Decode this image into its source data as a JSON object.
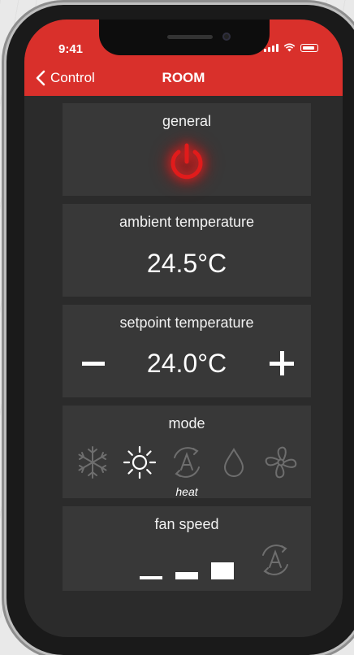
{
  "status_bar": {
    "time": "9:41"
  },
  "nav": {
    "back_label": "Control",
    "title": "ROOM"
  },
  "general": {
    "title": "general",
    "power_icon": "power-icon",
    "power_color": "#e11b1b"
  },
  "ambient": {
    "title": "ambient temperature",
    "value": "24.5°C"
  },
  "setpoint": {
    "title": "setpoint temperature",
    "value": "24.0°C"
  },
  "mode": {
    "title": "mode",
    "options": [
      "cool-icon",
      "heat-icon",
      "auto-icon",
      "dry-icon",
      "fan-icon"
    ],
    "selected_label": "heat"
  },
  "fan_speed": {
    "title": "fan speed",
    "options": [
      "low",
      "medium",
      "high",
      "auto"
    ]
  },
  "colors": {
    "accent": "#d9302b",
    "background": "#2b2b2b",
    "card": "#383838",
    "inactive": "#6e6e6e"
  }
}
